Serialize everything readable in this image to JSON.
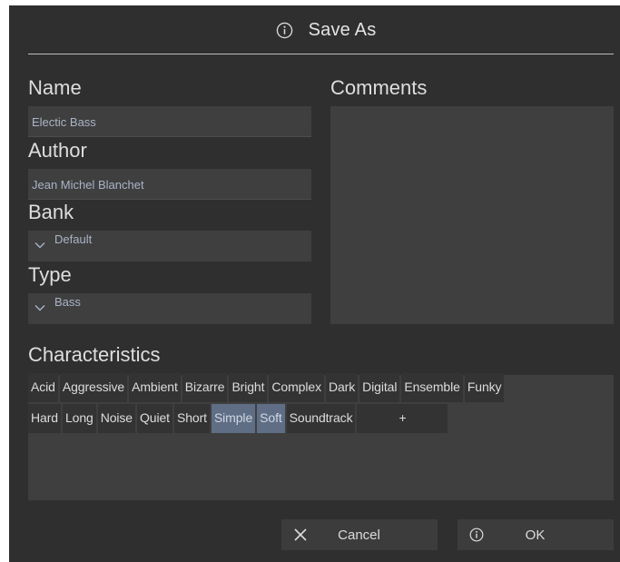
{
  "dialog": {
    "title": "Save As"
  },
  "form": {
    "name": {
      "label": "Name",
      "value": "Electic Bass"
    },
    "author": {
      "label": "Author",
      "value": "Jean Michel Blanchet"
    },
    "bank": {
      "label": "Bank",
      "value": "Default"
    },
    "type": {
      "label": "Type",
      "value": "Bass"
    },
    "comments": {
      "label": "Comments",
      "value": ""
    }
  },
  "characteristics": {
    "label": "Characteristics",
    "row1": [
      "Acid",
      "Aggressive",
      "Ambient",
      "Bizarre",
      "Bright",
      "Complex",
      "Dark",
      "Digital",
      "Ensemble",
      "Funky"
    ],
    "row2": [
      "Hard",
      "Long",
      "Noise",
      "Quiet",
      "Short",
      "Simple",
      "Soft",
      "Soundtrack"
    ],
    "selected": [
      "Simple",
      "Soft"
    ],
    "add_label": "+"
  },
  "buttons": {
    "cancel": "Cancel",
    "ok": "OK"
  },
  "icons": {
    "title": "info-icon",
    "cancel": "close-icon",
    "ok": "info-icon",
    "select": "chevron-down-icon"
  },
  "colors": {
    "background": "#2f2f2f",
    "field": "#3f3f3f",
    "field_text": "#a9b4c6",
    "selected_tag": "#5f6e85"
  }
}
